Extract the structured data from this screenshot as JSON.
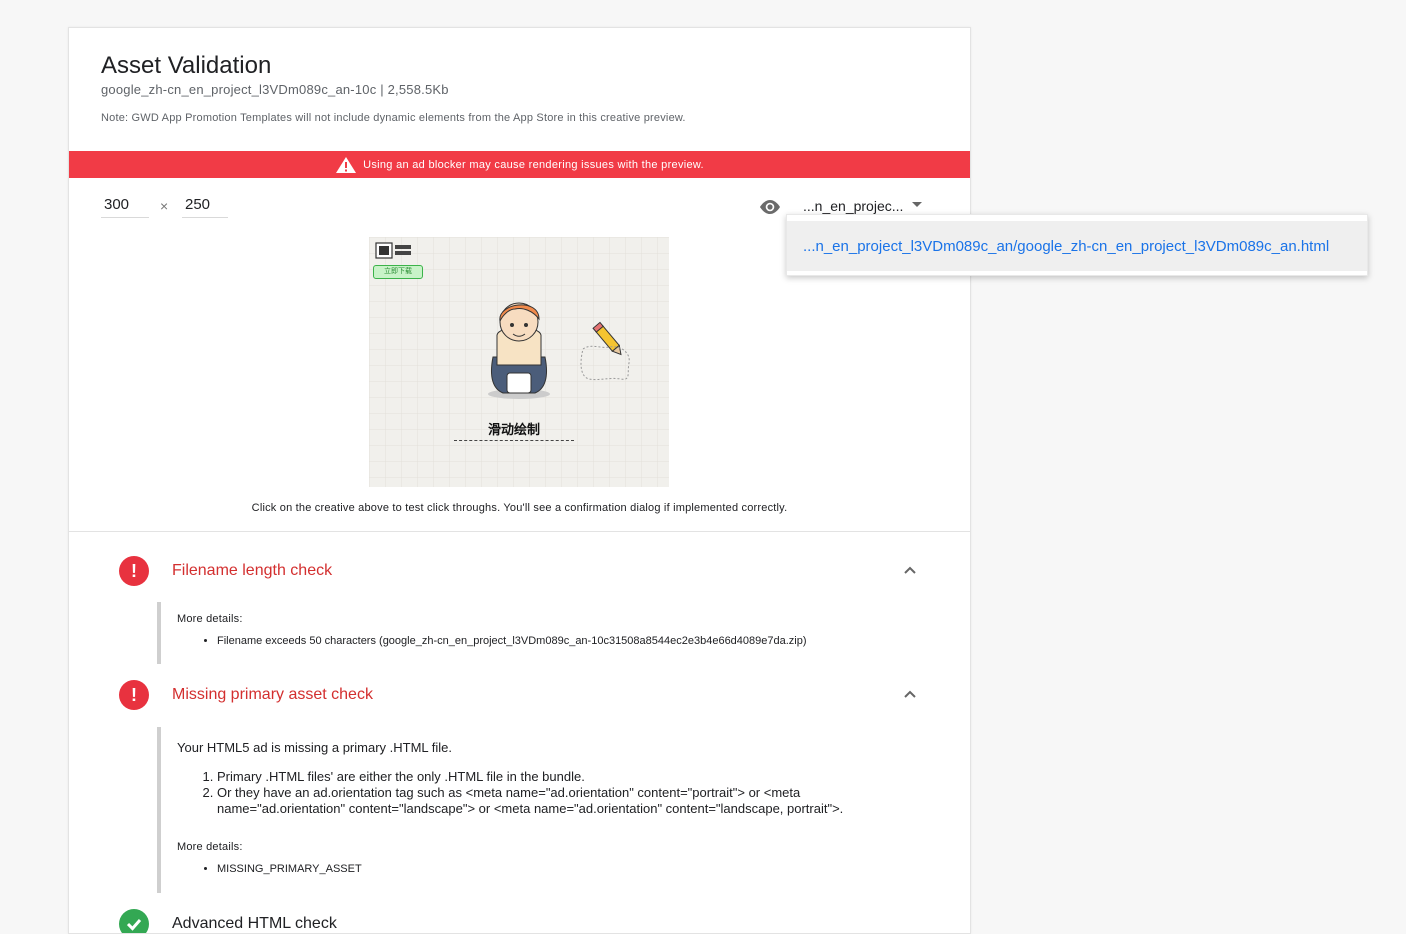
{
  "page": {
    "title": "Asset Validation",
    "subtitle": "google_zh-cn_en_project_l3VDm089c_an-10c | 2,558.5Kb",
    "note": "Note: GWD App Promotion Templates will not include dynamic elements from the App Store in this creative preview."
  },
  "banner": {
    "text": "Using an ad blocker may cause rendering issues with the preview.",
    "color": "#f13b46"
  },
  "dimensions": {
    "width": "300",
    "times": "×",
    "height": "250"
  },
  "file_select": {
    "selected": "...n_en_projec...",
    "options": [
      "...n_en_project_l3VDm089c_an/google_zh-cn_en_project_l3VDm089c_an.html"
    ]
  },
  "preview": {
    "download_label": "立即下载",
    "center_text": "滑动绘制",
    "caption": "Click on the creative above to test click throughs. You'll see a confirmation dialog if implemented correctly."
  },
  "checks": [
    {
      "status": "error",
      "title": "Filename length check",
      "details_label": "More details:",
      "details": [
        "Filename exceeds 50 characters (google_zh-cn_en_project_l3VDm089c_an-10c31508a8544ec2e3b4e66d4089e7da.zip)"
      ]
    },
    {
      "status": "error",
      "title": "Missing primary asset check",
      "message": "Your HTML5 ad is missing a primary .HTML file.",
      "reasons": [
        "Primary .HTML files' are either the only .HTML file in the bundle.",
        "Or they have an ad.orientation tag such as <meta name=\"ad.orientation\" content=\"portrait\"> or <meta name=\"ad.orientation\" content=\"landscape\"> or <meta name=\"ad.orientation\" content=\"landscape, portrait\">."
      ],
      "details_label": "More details:",
      "details": [
        "MISSING_PRIMARY_ASSET"
      ]
    },
    {
      "status": "ok",
      "title": "Advanced HTML check"
    }
  ],
  "colors": {
    "error": "#e8323f",
    "ok": "#33a853",
    "link": "#1a73e8"
  },
  "icons": {
    "error": "exclamation-circle-icon",
    "ok": "check-circle-icon",
    "eye": "eye-icon",
    "collapse": "chevron-up-icon",
    "warning": "warning-triangle-icon"
  }
}
